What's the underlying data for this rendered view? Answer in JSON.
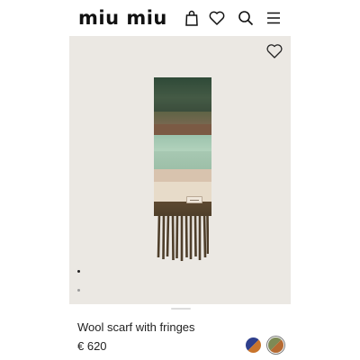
{
  "header": {
    "logo": "miu miu",
    "icons": [
      "shopping-bag-icon",
      "heart-icon",
      "search-icon",
      "menu-icon"
    ]
  },
  "product": {
    "name": "Wool scarf with fringes",
    "price": "€ 620",
    "wishlist_icon": "heart-icon",
    "carousel": {
      "total": 2,
      "active": 1
    },
    "swatches": [
      {
        "name": "color-swatch-blue-orange",
        "colors": [
          "#2e3f8c",
          "#c9752c"
        ],
        "selected": false
      },
      {
        "name": "color-swatch-green-brown",
        "colors": [
          "#7d8a55",
          "#b56a32"
        ],
        "selected": true
      }
    ]
  },
  "colors": {
    "stage_background": "#ebe8e3",
    "text": "#222222",
    "scarf_stripes": [
      "#3f5040",
      "#7a5a45",
      "#a9c9b2",
      "#d9c6b0",
      "#e9ddcc",
      "#5c4a32"
    ]
  }
}
